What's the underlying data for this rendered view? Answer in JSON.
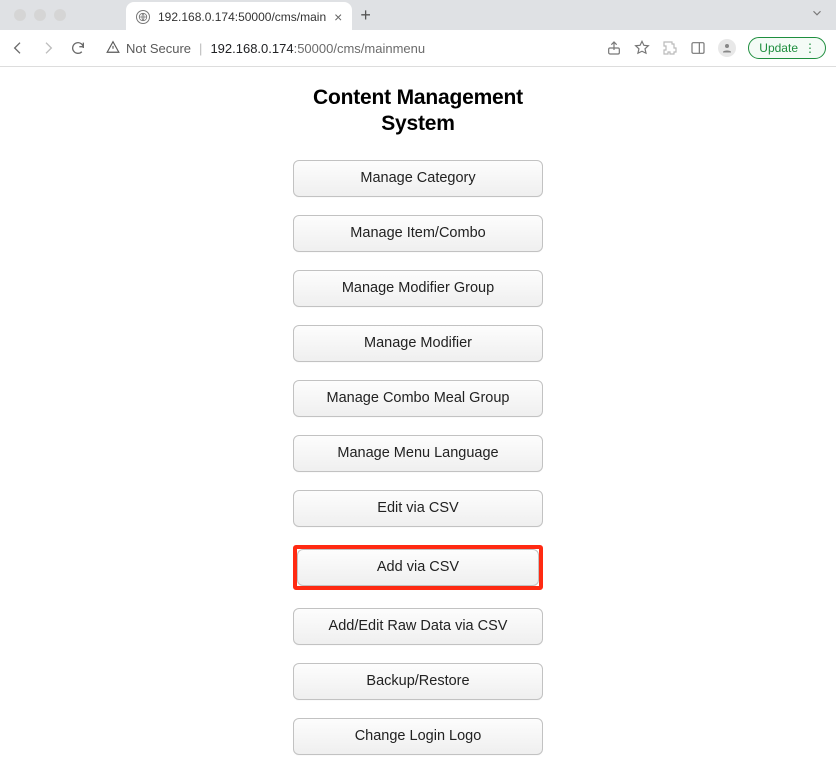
{
  "browser": {
    "tab_title": "192.168.0.174:50000/cms/main",
    "security_label": "Not Secure",
    "url_host": "192.168.0.174",
    "url_port": ":50000",
    "url_path": "/cms/mainmenu",
    "update_label": "Update"
  },
  "page": {
    "title_line1": "Content Management",
    "title_line2": "System"
  },
  "menu": {
    "items": [
      {
        "label": "Manage Category",
        "highlighted": false
      },
      {
        "label": "Manage Item/Combo",
        "highlighted": false
      },
      {
        "label": "Manage Modifier Group",
        "highlighted": false
      },
      {
        "label": "Manage Modifier",
        "highlighted": false
      },
      {
        "label": "Manage Combo Meal Group",
        "highlighted": false
      },
      {
        "label": "Manage Menu Language",
        "highlighted": false
      },
      {
        "label": "Edit via CSV",
        "highlighted": false
      },
      {
        "label": "Add via CSV",
        "highlighted": true
      },
      {
        "label": "Add/Edit Raw Data via CSV",
        "highlighted": false
      },
      {
        "label": "Backup/Restore",
        "highlighted": false
      },
      {
        "label": "Change Login Logo",
        "highlighted": false
      }
    ]
  }
}
